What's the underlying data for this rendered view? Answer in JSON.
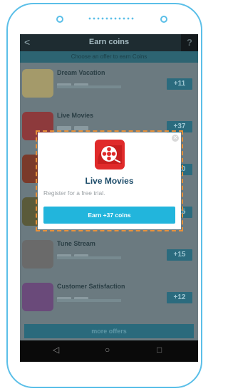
{
  "header": {
    "back": "<",
    "title": "Earn coins",
    "help": "?"
  },
  "subbar": {
    "text": "Choose an offer to earn Coins"
  },
  "offers": [
    {
      "name": "Dream Vacation",
      "reward": "+11"
    },
    {
      "name": "Live Movies",
      "reward": "+37"
    },
    {
      "name": "",
      "reward": "+20"
    },
    {
      "name": "",
      "reward": "+25"
    },
    {
      "name": "Tune Stream",
      "reward": "+15"
    },
    {
      "name": "Customer Satisfaction",
      "reward": "+12"
    }
  ],
  "more_offers": "more offers",
  "dialog": {
    "title": "Live Movies",
    "description": "Register for a free trial.",
    "button": "Earn +37 coins"
  },
  "nav": {
    "back": "◁",
    "home": "○",
    "recents": "□"
  },
  "colors": {
    "accent": "#22b5dc",
    "dialog_title": "#1f4e6b",
    "highlight": "#e8913a"
  }
}
